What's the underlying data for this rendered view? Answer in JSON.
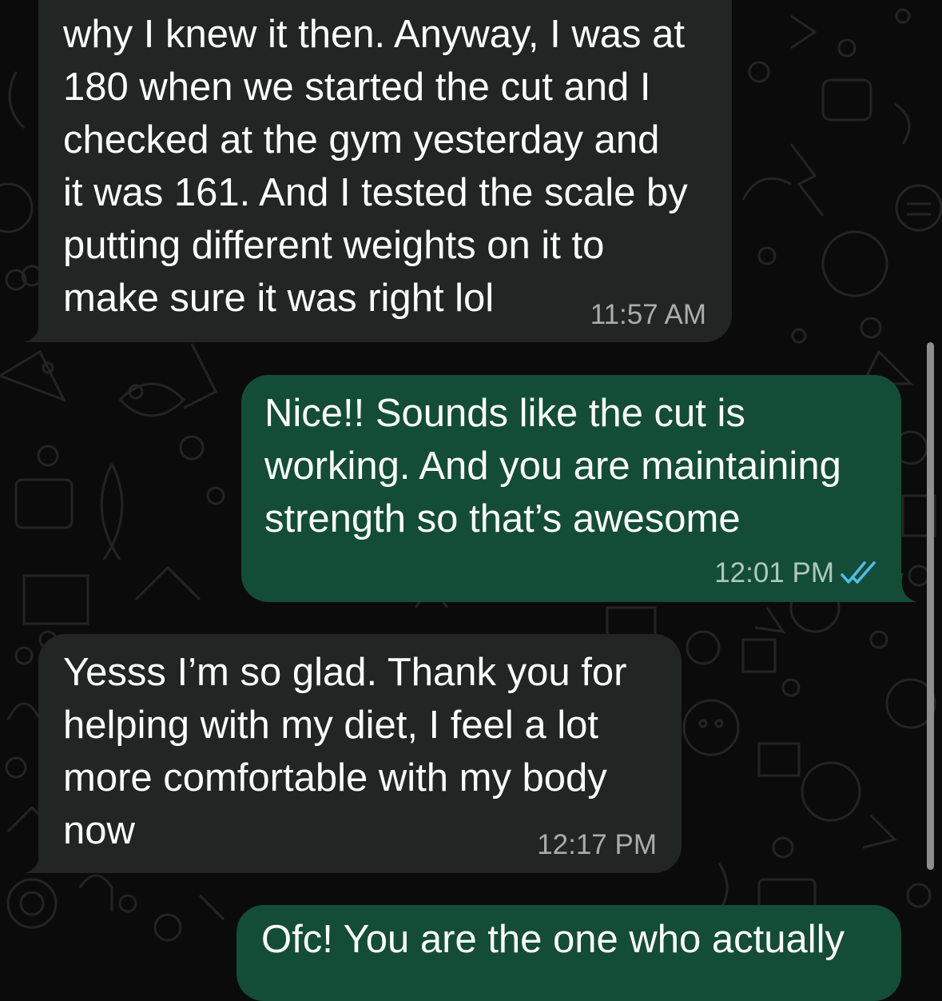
{
  "conversation": {
    "messages": [
      {
        "direction": "incoming",
        "text": "why I knew it then. Anyway, I was at\n180 when we started the cut and I\nchecked at the gym yesterday and\nit was 161. And I tested the scale by\nputting different weights on it to\nmake sure it was right lol",
        "time": "11:57 AM"
      },
      {
        "direction": "outgoing",
        "text": "Nice!! Sounds like the cut is\nworking. And you are maintaining\nstrength so that’s awesome",
        "time": "12:01 PM",
        "status_icon": "double-check-read-icon"
      },
      {
        "direction": "incoming",
        "text": "Yesss I’m so glad. Thank you for\nhelping with my diet, I feel a lot\nmore comfortable with my body\nnow",
        "time": "12:17 PM"
      },
      {
        "direction": "outgoing",
        "text": "Ofc! You are the one who actually"
      }
    ]
  },
  "theme": {
    "background": "#0b0b0b",
    "incoming_bubble": "#232525",
    "outgoing_bubble": "#134d37",
    "read_tick_color": "#53bdeb",
    "timestamp_color": "#a7aeab"
  }
}
